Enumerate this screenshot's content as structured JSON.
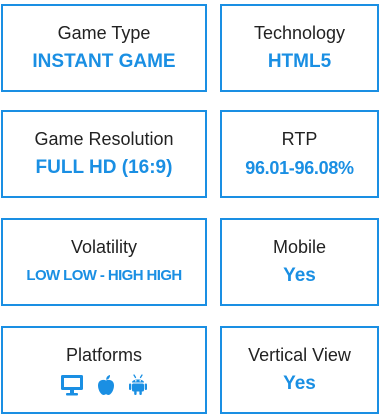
{
  "accent_color": "#1a8fe3",
  "cards": [
    {
      "label": "Game Type",
      "value": "INSTANT GAME"
    },
    {
      "label": "Technology",
      "value": "HTML5"
    },
    {
      "label": "Game Resolution",
      "value": "FULL HD (16:9)"
    },
    {
      "label": "RTP",
      "value": "96.01-96.08%"
    },
    {
      "label": "Volatility",
      "value": "LOW LOW - HIGH HIGH"
    },
    {
      "label": "Mobile",
      "value": "Yes"
    },
    {
      "label": "Platforms",
      "icons": [
        "desktop-icon",
        "apple-icon",
        "android-icon"
      ]
    },
    {
      "label": "Vertical View",
      "value": "Yes"
    }
  ]
}
